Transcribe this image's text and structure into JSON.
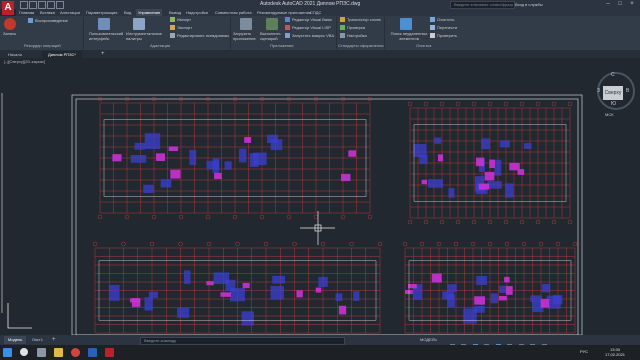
{
  "title": "Autodesk AutoCAD 2021  Диплом РПЗС.dwg",
  "search_placeholder": "Введите ключевое слово/фразу",
  "signin": "Вход в службы",
  "ribbon_tabs": [
    "Главная",
    "Вставка",
    "Аннотации",
    "Параметризация",
    "Вид",
    "Управление",
    "Вывод",
    "Надстройки",
    "Совместная работа",
    "Рекомендуемые приложения",
    "СПДС"
  ],
  "active_tab": "Управление",
  "ribbon": {
    "record": {
      "big": "Запись",
      "items": [
        "Воспроизведение"
      ],
      "panel": "Рекордер операций"
    },
    "adapt": {
      "big1": "Пользовательский интерфейс",
      "big2": "Инструментальные палитры",
      "items": [
        "Импорт",
        "Экспорт",
        "Редактировать псевдонимы"
      ],
      "panel": "Адаптация"
    },
    "apps": {
      "big1": "Загрузить приложение",
      "big2": "Выполнить сценарий",
      "items": [
        "Редактор Visual Basic",
        "Редактор Visual LISP",
        "Запустить макрос VBA"
      ],
      "panel": "Приложения"
    },
    "cad_std": {
      "items": [
        "Транслятор слоев",
        "Проверка",
        "Настройка"
      ],
      "panel": "Стандарты оформления"
    },
    "cleanup": {
      "big": "Поиск неудаленных элементов",
      "items": [
        "Очистить",
        "Перенести",
        "Проверить"
      ],
      "panel": "Очистка"
    }
  },
  "doc_tabs": [
    "Начало",
    "Диплом РПЗС*"
  ],
  "view_label": "[–][Сверху][2D-каркас]",
  "viewcube": {
    "face": "Сверху",
    "north": "С",
    "south": "Ю",
    "west": "З",
    "east": "В",
    "ucs": "МСК"
  },
  "status_tabs": [
    "Модель",
    "Лист1"
  ],
  "active_status_tab": "Модель",
  "cmd_placeholder": "Введите команду",
  "model_status": "МОДЕЛЬ",
  "lang": "РУС",
  "clock_time": "13:30",
  "clock_date": "17.02.2021",
  "colors": {
    "bg": "#212830",
    "red": "#d63a3a",
    "magenta": "#c931d6",
    "blue": "#3b3fd0",
    "white": "#e8eaee"
  }
}
